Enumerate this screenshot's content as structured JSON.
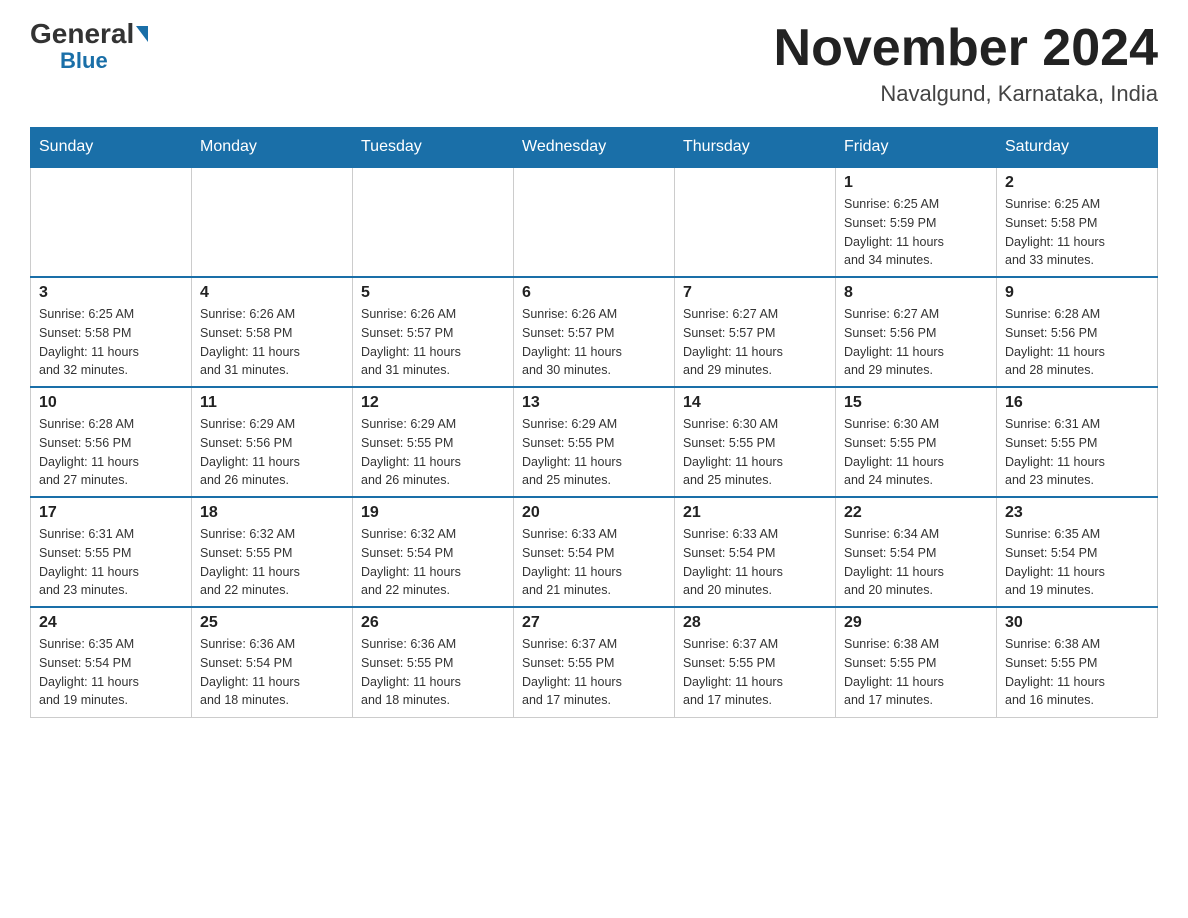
{
  "logo": {
    "general": "General",
    "blue": "Blue"
  },
  "title": "November 2024",
  "location": "Navalgund, Karnataka, India",
  "weekdays": [
    "Sunday",
    "Monday",
    "Tuesday",
    "Wednesday",
    "Thursday",
    "Friday",
    "Saturday"
  ],
  "weeks": [
    [
      {
        "day": "",
        "info": ""
      },
      {
        "day": "",
        "info": ""
      },
      {
        "day": "",
        "info": ""
      },
      {
        "day": "",
        "info": ""
      },
      {
        "day": "",
        "info": ""
      },
      {
        "day": "1",
        "info": "Sunrise: 6:25 AM\nSunset: 5:59 PM\nDaylight: 11 hours\nand 34 minutes."
      },
      {
        "day": "2",
        "info": "Sunrise: 6:25 AM\nSunset: 5:58 PM\nDaylight: 11 hours\nand 33 minutes."
      }
    ],
    [
      {
        "day": "3",
        "info": "Sunrise: 6:25 AM\nSunset: 5:58 PM\nDaylight: 11 hours\nand 32 minutes."
      },
      {
        "day": "4",
        "info": "Sunrise: 6:26 AM\nSunset: 5:58 PM\nDaylight: 11 hours\nand 31 minutes."
      },
      {
        "day": "5",
        "info": "Sunrise: 6:26 AM\nSunset: 5:57 PM\nDaylight: 11 hours\nand 31 minutes."
      },
      {
        "day": "6",
        "info": "Sunrise: 6:26 AM\nSunset: 5:57 PM\nDaylight: 11 hours\nand 30 minutes."
      },
      {
        "day": "7",
        "info": "Sunrise: 6:27 AM\nSunset: 5:57 PM\nDaylight: 11 hours\nand 29 minutes."
      },
      {
        "day": "8",
        "info": "Sunrise: 6:27 AM\nSunset: 5:56 PM\nDaylight: 11 hours\nand 29 minutes."
      },
      {
        "day": "9",
        "info": "Sunrise: 6:28 AM\nSunset: 5:56 PM\nDaylight: 11 hours\nand 28 minutes."
      }
    ],
    [
      {
        "day": "10",
        "info": "Sunrise: 6:28 AM\nSunset: 5:56 PM\nDaylight: 11 hours\nand 27 minutes."
      },
      {
        "day": "11",
        "info": "Sunrise: 6:29 AM\nSunset: 5:56 PM\nDaylight: 11 hours\nand 26 minutes."
      },
      {
        "day": "12",
        "info": "Sunrise: 6:29 AM\nSunset: 5:55 PM\nDaylight: 11 hours\nand 26 minutes."
      },
      {
        "day": "13",
        "info": "Sunrise: 6:29 AM\nSunset: 5:55 PM\nDaylight: 11 hours\nand 25 minutes."
      },
      {
        "day": "14",
        "info": "Sunrise: 6:30 AM\nSunset: 5:55 PM\nDaylight: 11 hours\nand 25 minutes."
      },
      {
        "day": "15",
        "info": "Sunrise: 6:30 AM\nSunset: 5:55 PM\nDaylight: 11 hours\nand 24 minutes."
      },
      {
        "day": "16",
        "info": "Sunrise: 6:31 AM\nSunset: 5:55 PM\nDaylight: 11 hours\nand 23 minutes."
      }
    ],
    [
      {
        "day": "17",
        "info": "Sunrise: 6:31 AM\nSunset: 5:55 PM\nDaylight: 11 hours\nand 23 minutes."
      },
      {
        "day": "18",
        "info": "Sunrise: 6:32 AM\nSunset: 5:55 PM\nDaylight: 11 hours\nand 22 minutes."
      },
      {
        "day": "19",
        "info": "Sunrise: 6:32 AM\nSunset: 5:54 PM\nDaylight: 11 hours\nand 22 minutes."
      },
      {
        "day": "20",
        "info": "Sunrise: 6:33 AM\nSunset: 5:54 PM\nDaylight: 11 hours\nand 21 minutes."
      },
      {
        "day": "21",
        "info": "Sunrise: 6:33 AM\nSunset: 5:54 PM\nDaylight: 11 hours\nand 20 minutes."
      },
      {
        "day": "22",
        "info": "Sunrise: 6:34 AM\nSunset: 5:54 PM\nDaylight: 11 hours\nand 20 minutes."
      },
      {
        "day": "23",
        "info": "Sunrise: 6:35 AM\nSunset: 5:54 PM\nDaylight: 11 hours\nand 19 minutes."
      }
    ],
    [
      {
        "day": "24",
        "info": "Sunrise: 6:35 AM\nSunset: 5:54 PM\nDaylight: 11 hours\nand 19 minutes."
      },
      {
        "day": "25",
        "info": "Sunrise: 6:36 AM\nSunset: 5:54 PM\nDaylight: 11 hours\nand 18 minutes."
      },
      {
        "day": "26",
        "info": "Sunrise: 6:36 AM\nSunset: 5:55 PM\nDaylight: 11 hours\nand 18 minutes."
      },
      {
        "day": "27",
        "info": "Sunrise: 6:37 AM\nSunset: 5:55 PM\nDaylight: 11 hours\nand 17 minutes."
      },
      {
        "day": "28",
        "info": "Sunrise: 6:37 AM\nSunset: 5:55 PM\nDaylight: 11 hours\nand 17 minutes."
      },
      {
        "day": "29",
        "info": "Sunrise: 6:38 AM\nSunset: 5:55 PM\nDaylight: 11 hours\nand 17 minutes."
      },
      {
        "day": "30",
        "info": "Sunrise: 6:38 AM\nSunset: 5:55 PM\nDaylight: 11 hours\nand 16 minutes."
      }
    ]
  ]
}
